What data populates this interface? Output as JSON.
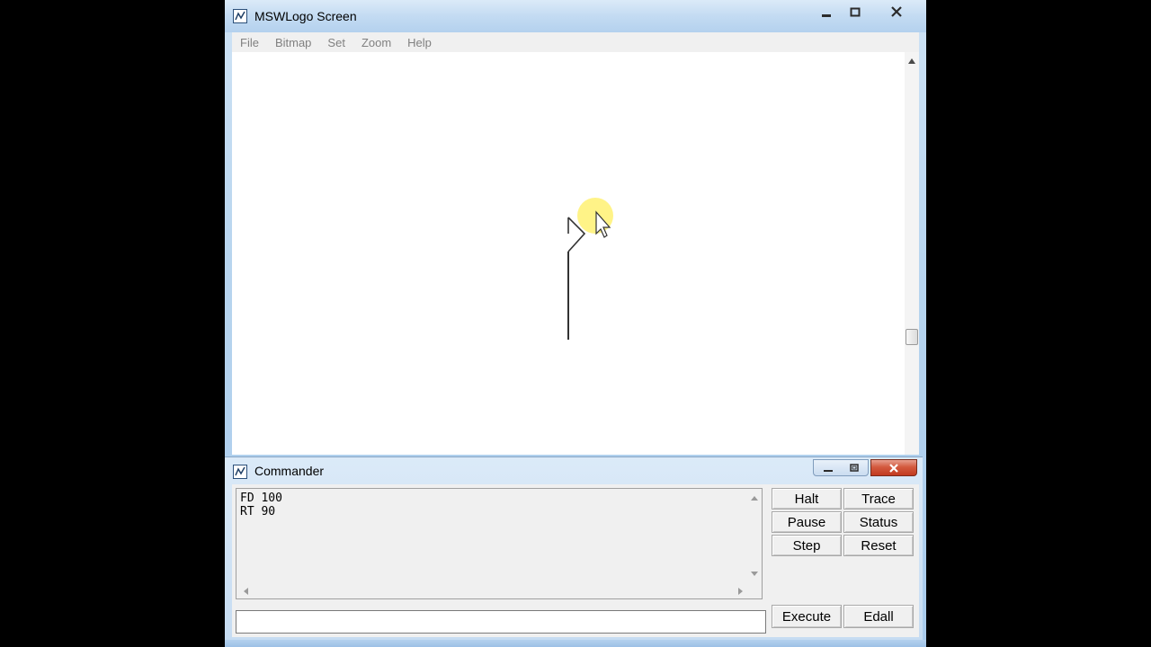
{
  "main_window": {
    "title": "MSWLogo Screen",
    "menu": [
      "File",
      "Bitmap",
      "Set",
      "Zoom",
      "Help"
    ]
  },
  "commander": {
    "title": "Commander",
    "history": [
      "FD 100",
      "RT 90"
    ],
    "input_value": "",
    "buttons": {
      "halt": "Halt",
      "trace": "Trace",
      "pause": "Pause",
      "status": "Status",
      "step": "Step",
      "reset": "Reset",
      "execute": "Execute",
      "edall": "Edall"
    }
  },
  "colors": {
    "pen": "#333333",
    "cursor_highlight": "#fff27a",
    "close_button": "#c8402a"
  },
  "icons": [
    "logo-app-icon",
    "minimize-icon",
    "maximize-icon",
    "close-icon",
    "restore-icon",
    "turtle-icon",
    "mouse-pointer-icon"
  ]
}
